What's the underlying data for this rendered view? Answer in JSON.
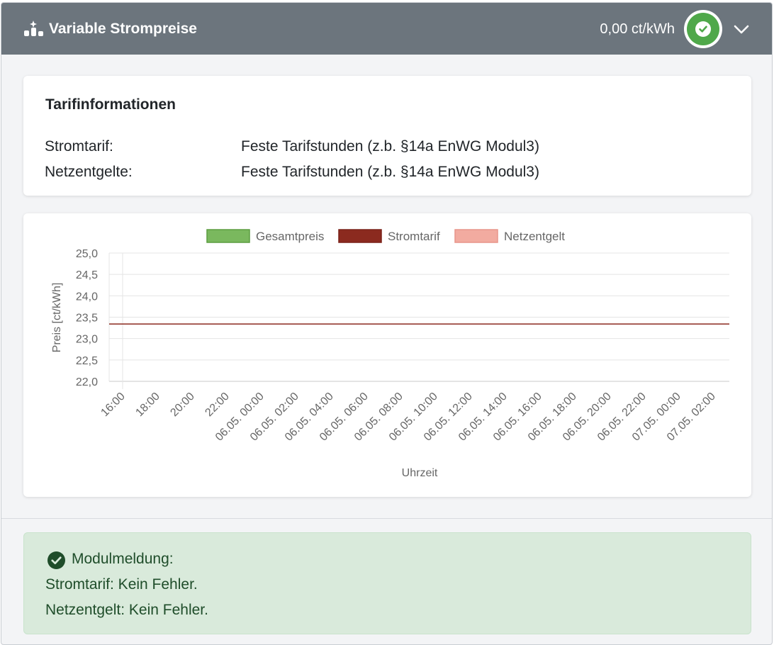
{
  "header": {
    "title": "Variable Strompreise",
    "price": "0,00 ct/kWh",
    "status_icon": "check-circle-icon",
    "accent_green": "#4fa84a"
  },
  "tariff": {
    "heading": "Tarifinformationen",
    "rows": [
      {
        "label": "Stromtarif:",
        "value": "Feste Tarifstunden (z.b. §14a EnWG Modul3)"
      },
      {
        "label": "Netzentgelte:",
        "value": "Feste Tarifstunden (z.b. §14a EnWG Modul3)"
      }
    ]
  },
  "chart_data": {
    "type": "line",
    "legend_position": "top",
    "series": [
      {
        "name": "Gesamtpreis",
        "color": "#7ab85e",
        "values": []
      },
      {
        "name": "Stromtarif",
        "color": "#8b2a1f",
        "values": [
          23.34,
          23.34
        ]
      },
      {
        "name": "Netzentgelt",
        "color": "#f2aba0",
        "values": []
      }
    ],
    "x": [
      "16:00",
      "18:00",
      "20:00",
      "22:00",
      "06.05. 00:00",
      "06.05. 02:00",
      "06.05. 04:00",
      "06.05. 06:00",
      "06.05. 08:00",
      "06.05. 10:00",
      "06.05. 12:00",
      "06.05. 14:00",
      "06.05. 16:00",
      "06.05. 18:00",
      "06.05. 20:00",
      "06.05. 22:00",
      "07.05. 00:00",
      "07.05. 02:00"
    ],
    "y_ticks": [
      "25,0",
      "24,5",
      "24,0",
      "23,5",
      "23,0",
      "22,5",
      "22,0"
    ],
    "ylim": [
      22.0,
      25.0
    ],
    "xlabel": "Uhrzeit",
    "ylabel": "Preis [ct/kWh]",
    "grid": true
  },
  "message": {
    "title": "Modulmeldung:",
    "lines": [
      "Stromtarif: Kein Fehler.",
      "Netzentgelt: Kein Fehler."
    ]
  }
}
